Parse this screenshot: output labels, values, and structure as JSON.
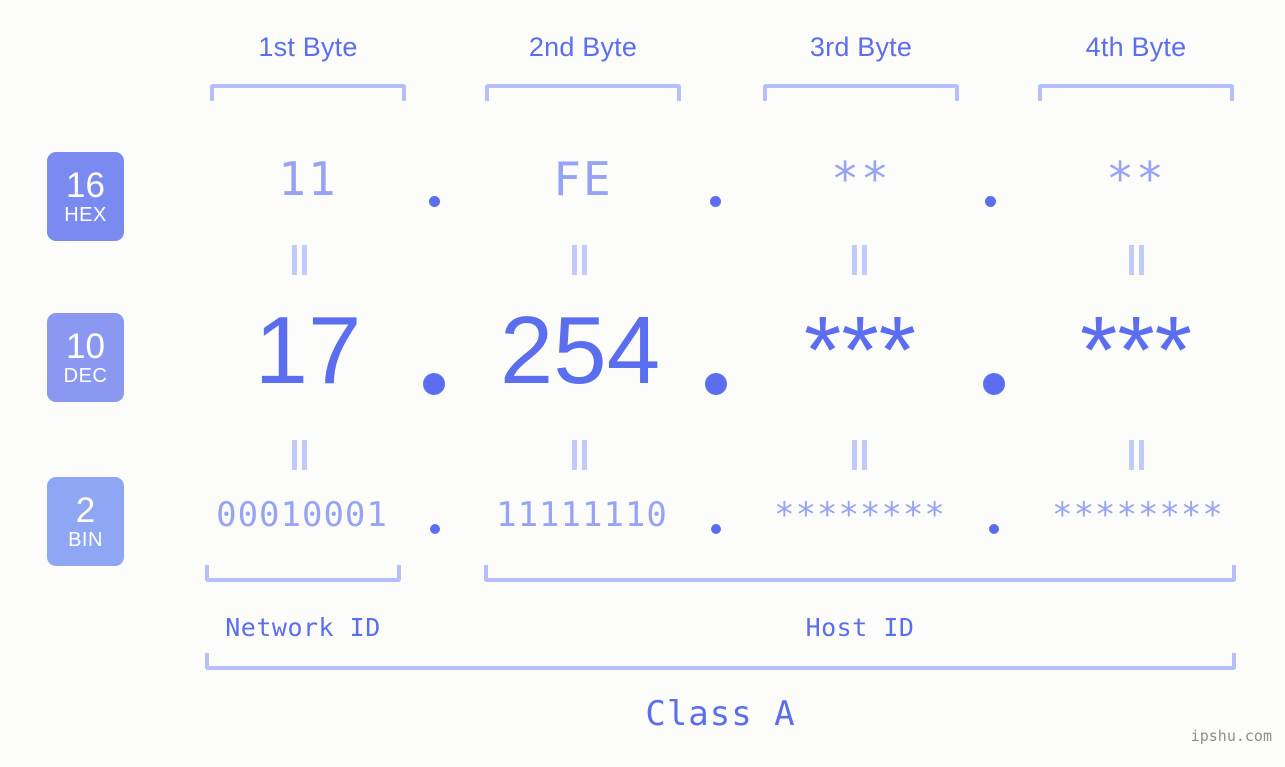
{
  "background_color": "#fcfdfa",
  "accent_color": "#5b6ef0",
  "muted_accent_color": "#97a3f5",
  "bracket_color": "#b6bffa",
  "watermark": "ipshu.com",
  "headers": {
    "byte1": "1st Byte",
    "byte2": "2nd Byte",
    "byte3": "3rd Byte",
    "byte4": "4th Byte"
  },
  "bases": [
    {
      "number": "16",
      "name": "HEX",
      "color": "#7b8af0"
    },
    {
      "number": "10",
      "name": "DEC",
      "color": "#8b98f2"
    },
    {
      "number": "2",
      "name": "BIN",
      "color": "#8fa6f5"
    }
  ],
  "rows": {
    "hex": {
      "base_number": "16",
      "base_name": "HEX",
      "values": [
        "11",
        "FE",
        "**",
        "**"
      ],
      "separator": "."
    },
    "dec": {
      "base_number": "10",
      "base_name": "DEC",
      "values": [
        "17",
        "254",
        "***",
        "***"
      ],
      "separator": "."
    },
    "bin": {
      "base_number": "2",
      "base_name": "BIN",
      "values": [
        "00010001",
        "11111110",
        "********",
        "********"
      ],
      "separator": "."
    }
  },
  "equals_symbol": "||",
  "footer": {
    "network_id": "Network ID",
    "host_id": "Host ID",
    "class_label": "Class A"
  }
}
